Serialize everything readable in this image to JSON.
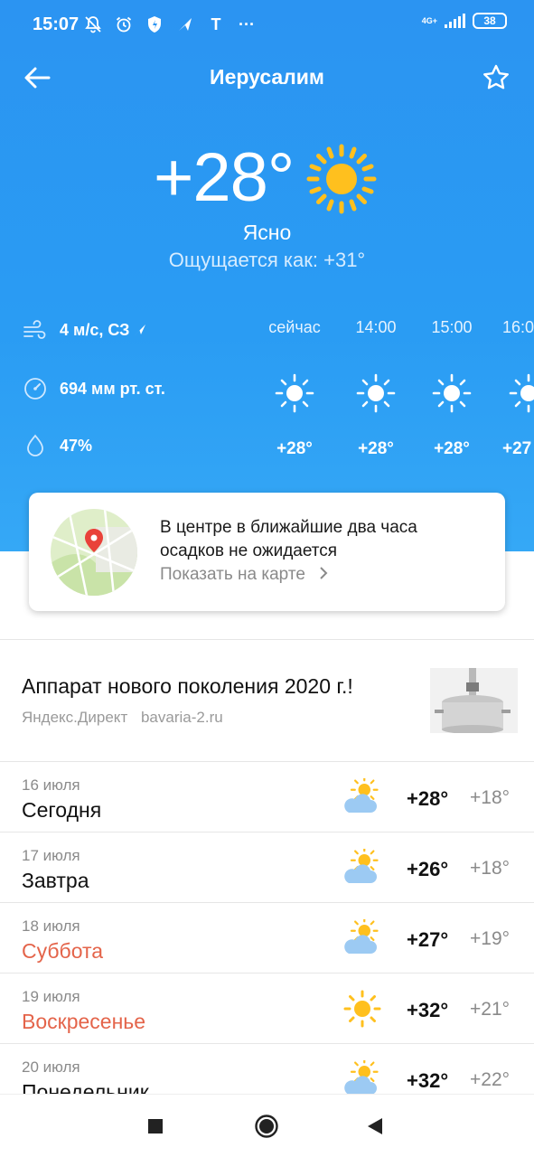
{
  "status_bar": {
    "time": "15:07",
    "network": "4G+",
    "battery": "38",
    "icons": [
      "mute-bell-icon",
      "alarm-icon",
      "shield-icon",
      "send-icon",
      "tinkoff-icon",
      "more-icon"
    ],
    "more_label": "···",
    "t_label": "T"
  },
  "header": {
    "city": "Иерусалим",
    "back_icon": "arrow-left-icon",
    "favorite_icon": "star-outline-icon"
  },
  "current": {
    "temperature": "+28°",
    "condition": "Ясно",
    "feels_like": "Ощущается как: +31°",
    "icon": "sun-icon"
  },
  "details": {
    "wind": "4 м/с, СЗ",
    "pressure": "694 мм рт. ст.",
    "humidity": "47%"
  },
  "hourly": [
    {
      "label": "сейчас",
      "temp": "+28°",
      "icon": "sun-icon"
    },
    {
      "label": "14:00",
      "temp": "+28°",
      "icon": "sun-icon"
    },
    {
      "label": "15:00",
      "temp": "+28°",
      "icon": "sun-icon"
    },
    {
      "label": "16:0",
      "temp": "+27",
      "icon": "sun-icon"
    }
  ],
  "nowcast": {
    "text": "В центре в ближайшие два часа осадков не ожидается",
    "link": "Показать на карте"
  },
  "ad": {
    "title": "Аппарат нового поколения 2020 г.!",
    "source": "Яндекс.Директ",
    "domain": "bavaria-2.ru"
  },
  "forecast": [
    {
      "date": "16 июля",
      "day": "Сегодня",
      "max": "+28°",
      "min": "+18°",
      "icon": "sun-cloud-icon",
      "weekend": false
    },
    {
      "date": "17 июля",
      "day": "Завтра",
      "max": "+26°",
      "min": "+18°",
      "icon": "sun-cloud-icon",
      "weekend": false
    },
    {
      "date": "18 июля",
      "day": "Суббота",
      "max": "+27°",
      "min": "+19°",
      "icon": "sun-cloud-icon",
      "weekend": true
    },
    {
      "date": "19 июля",
      "day": "Воскресенье",
      "max": "+32°",
      "min": "+21°",
      "icon": "sun-icon",
      "weekend": true
    },
    {
      "date": "20 июля",
      "day": "Понедельник",
      "max": "+32°",
      "min": "+22°",
      "icon": "sun-cloud-icon",
      "weekend": false
    }
  ],
  "colors": {
    "sky": "#2a9cf3",
    "sun": "#ffc01e",
    "weekend": "#e4644a"
  },
  "nav": [
    "recents-button",
    "home-button",
    "back-button"
  ]
}
